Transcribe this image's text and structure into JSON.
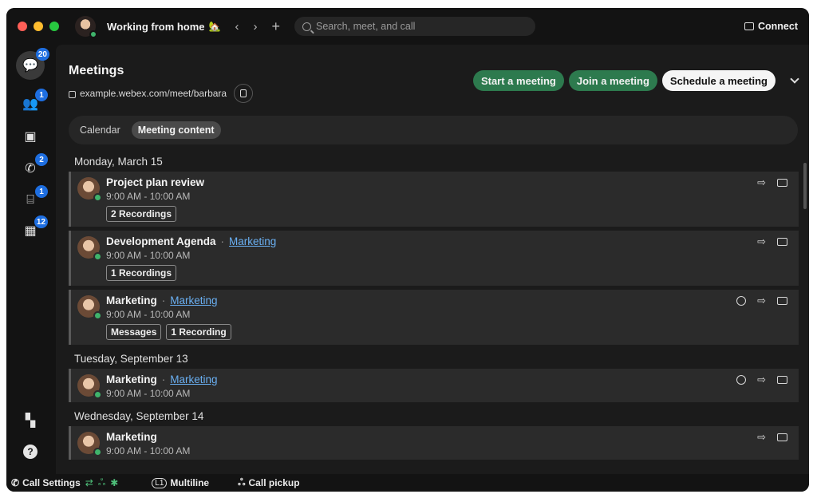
{
  "window": {
    "status_text": "Working from home",
    "status_emoji": "🏡",
    "search_placeholder": "Search, meet, and call",
    "connect_label": "Connect"
  },
  "rail": {
    "items": [
      {
        "name": "messaging-icon",
        "glyph": "💬",
        "badge": "20"
      },
      {
        "name": "teams-icon",
        "glyph": "👥",
        "badge": "1"
      },
      {
        "name": "contacts-icon",
        "glyph": "▣",
        "badge": ""
      },
      {
        "name": "calls-icon",
        "glyph": "✆",
        "badge": "2"
      },
      {
        "name": "voicemail-icon",
        "glyph": "⌸",
        "badge": "1"
      },
      {
        "name": "meetings-calendar-icon",
        "glyph": "▦",
        "badge": "12"
      }
    ],
    "help_glyph": "?",
    "apps_glyph": "▚"
  },
  "header": {
    "title": "Meetings",
    "meeting_link": "example.webex.com/meet/barbara",
    "buttons": {
      "start": "Start a meeting",
      "join": "Join a meeting",
      "schedule": "Schedule a meeting"
    }
  },
  "tabs": [
    {
      "label": "Calendar",
      "selected": false
    },
    {
      "label": "Meeting content",
      "selected": true
    }
  ],
  "groups": [
    {
      "date": "Monday, March 15",
      "meetings": [
        {
          "title": "Project plan review",
          "space": "",
          "time": "9:00 AM - 10:00 AM",
          "chips": [
            "2 Recordings"
          ],
          "chat": false
        },
        {
          "title": "Development Agenda",
          "space": "Marketing",
          "time": "9:00 AM - 10:00 AM",
          "chips": [
            "1 Recordings"
          ],
          "chat": false
        },
        {
          "title": "Marketing",
          "space": "Marketing",
          "time": "9:00 AM - 10:00 AM",
          "chips": [
            "Messages",
            "1 Recording"
          ],
          "chat": true
        }
      ]
    },
    {
      "date": "Tuesday, September 13",
      "meetings": [
        {
          "title": "Marketing",
          "space": "Marketing",
          "time": "9:00 AM - 10:00 AM",
          "chips": [],
          "chat": true
        }
      ]
    },
    {
      "date": "Wednesday, September 14",
      "meetings": [
        {
          "title": "Marketing",
          "space": "",
          "time": "9:00 AM - 10:00 AM",
          "chips": [],
          "chat": false
        }
      ]
    }
  ],
  "bottom_bar": {
    "call_settings": "Call Settings",
    "multiline_badge": "L1",
    "multiline": "Multiline",
    "call_pickup": "Call pickup"
  },
  "colors": {
    "accent_green": "#2d7a4e",
    "presence_green": "#3fb36b",
    "badge_blue": "#1e6ee0",
    "link_blue": "#6ab0f3"
  }
}
